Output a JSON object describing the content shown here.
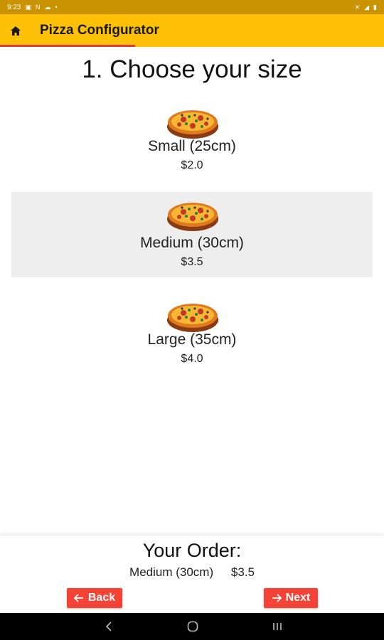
{
  "status_bar": {
    "time": "9:23",
    "left_icons": [
      "image-icon",
      "n-icon",
      "cloud-icon",
      "dot-icon"
    ],
    "right_icons": [
      "mute-icon",
      "signal-icon",
      "battery-icon"
    ]
  },
  "app_bar": {
    "title": "Pizza Configurator",
    "home_icon": "home-icon",
    "color": "#ffc107",
    "underline_color": "#e53935"
  },
  "heading": "1. Choose your size",
  "sizes": [
    {
      "label": "Small (25cm)",
      "price": "$2.0",
      "selected": false
    },
    {
      "label": "Medium (30cm)",
      "price": "$3.5",
      "selected": true
    },
    {
      "label": "Large (35cm)",
      "price": "$4.0",
      "selected": false
    }
  ],
  "order": {
    "title": "Your Order:",
    "size": "Medium (30cm)",
    "price": "$3.5"
  },
  "buttons": {
    "back_label": "Back",
    "next_label": "Next",
    "color": "#f44336"
  },
  "nav_bar": {
    "icons": [
      "back-nav-icon",
      "home-nav-icon",
      "recents-nav-icon"
    ]
  }
}
